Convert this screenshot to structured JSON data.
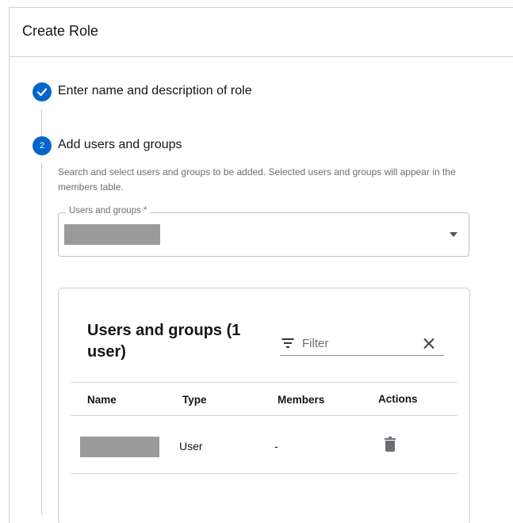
{
  "header": {
    "title": "Create Role"
  },
  "steps": [
    {
      "number": "1",
      "title": "Enter name and description of role",
      "completed": true
    },
    {
      "number": "2",
      "title": "Add users and groups",
      "completed": false
    }
  ],
  "add_users": {
    "helper_text": "Search and select users and groups to be added. Selected users and groups will appear in the members table.",
    "field_label": "Users and groups *"
  },
  "members_table": {
    "title": "Users and groups (1 user)",
    "filter_placeholder": "Filter",
    "columns": [
      "Name",
      "Type",
      "Members",
      "Actions"
    ],
    "rows": [
      {
        "type": "User",
        "members": "-"
      }
    ]
  },
  "colors": {
    "accent": "#0066cc",
    "border": "#d2d2d2",
    "redacted": "#9a9a9a"
  }
}
